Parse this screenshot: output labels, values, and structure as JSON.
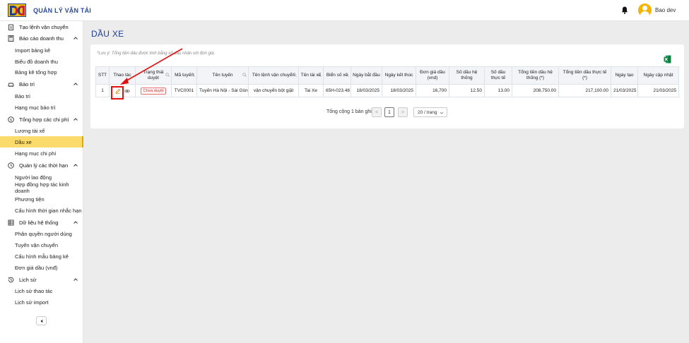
{
  "header": {
    "app_title": "QUẢN LÝ VẬN TẢI",
    "username": "Bao dev",
    "icons": {
      "bell": "bell-icon",
      "avatar": "user-avatar-icon"
    },
    "accent_color": "#f5b400"
  },
  "sidebar": {
    "sections": [
      {
        "label": "Tạo lệnh vận chuyển",
        "icon": "clipboard-icon",
        "items": []
      },
      {
        "label": "Báo cáo doanh thu",
        "icon": "calculator-icon",
        "items": [
          "Import bảng kê",
          "Biểu đồ doanh thu",
          "Bảng kê tổng hợp"
        ]
      },
      {
        "label": "Bảo trì",
        "icon": "car-icon",
        "items": [
          "Bảo trì",
          "Hạng mục bảo trì"
        ]
      },
      {
        "label": "Tổng hợp các chi phí",
        "icon": "dollar-icon",
        "items": [
          "Lương tài xế",
          "Dầu xe",
          "Hạng mục chi phí"
        ]
      },
      {
        "label": "Quản lý các thời hạn",
        "icon": "clock-icon",
        "items": [
          "Người lao động",
          "Hợp đồng hợp tác kinh doanh",
          "Phương tiện",
          "Cấu hình thời gian nhắc hạn"
        ]
      },
      {
        "label": "Dữ liệu hệ thống",
        "icon": "database-icon",
        "items": [
          "Phân quyền người dùng",
          "Tuyến vận chuyển",
          "Cấu hình mẫu bảng kê",
          "Đơn giá dầu (vnđ)"
        ]
      },
      {
        "label": "Lịch sử",
        "icon": "history-icon",
        "items": [
          "Lịch sử thao tác",
          "Lịch sử import"
        ]
      }
    ],
    "active_item": "Dầu xe",
    "active_color": "#fadb6b"
  },
  "page": {
    "title": "DẦU XE",
    "note": "*Lưu ý: Tổng tiền dầu được tính bằng số dầu nhân với đơn giá."
  },
  "table": {
    "columns": [
      "STT",
      "Thao tác",
      "Trạng thái duyệt",
      "Mã tuyến",
      "Tên tuyến",
      "Tên lệnh vận chuyển",
      "Tên tài xế",
      "Biển số xe",
      "Ngày bắt đầu",
      "Ngày kết thúc",
      "Đơn giá dầu (vnd)",
      "Số dầu hệ thống",
      "Số dầu thực tế",
      "Tổng tiền dầu hệ thống (*)",
      "Tổng tiền dầu thực tế (*)",
      "Ngày tạo",
      "Ngày cập nhật"
    ],
    "rows": [
      {
        "stt": "1",
        "status": "Chưa duyệt",
        "ma_tuyen": "TVC0001",
        "ten_tuyen": "Tuyến Hà Nội - Sài Gòn",
        "ten_lenh": "vận chuyển bột giặt",
        "tai_xe": "Tai Xe",
        "bien_so": "65H-023.48",
        "ngay_bat_dau": "18/03/2025",
        "ngay_ket_thuc": "18/03/2025",
        "don_gia": "16,700",
        "so_dau_he_thong": "12.50",
        "so_dau_thuc_te": "13.00",
        "tong_he_thong": "208,750.00",
        "tong_thuc_te": "217,100.00",
        "ngay_tao": "21/03/2025",
        "ngay_cap_nhat": "21/03/2025"
      }
    ]
  },
  "pagination": {
    "total_label": "Tổng cộng 1 bản ghi",
    "prev": "<",
    "current_page": "1",
    "next": ">",
    "page_size": "20 / trang"
  }
}
